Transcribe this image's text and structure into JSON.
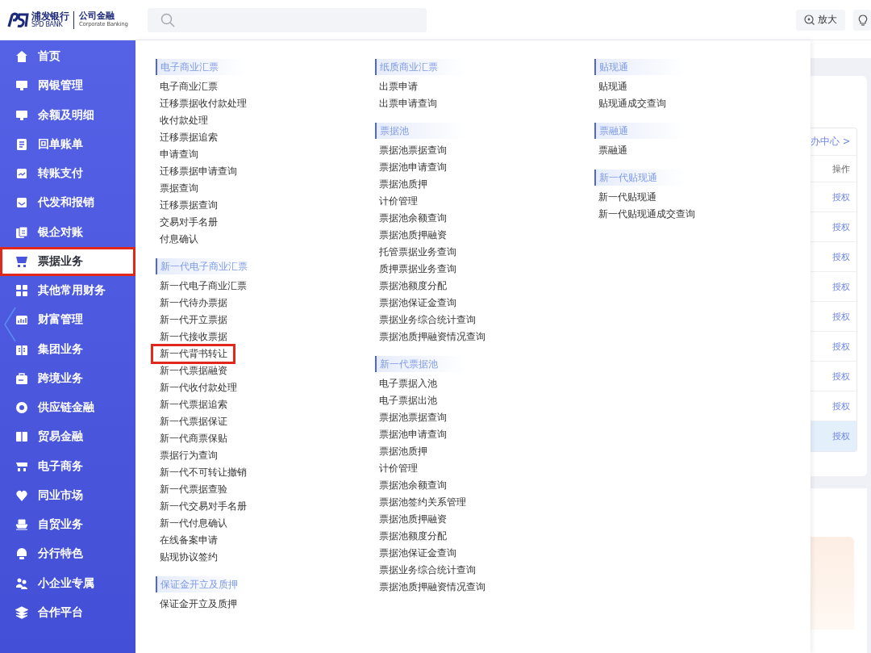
{
  "header": {
    "logo": {
      "bank_name": "浦发银行",
      "bank_name_en": "SPD BANK",
      "division": "公司金融",
      "division_en": "Corporate Banking"
    },
    "buttons": [
      {
        "kind": "zoom",
        "label": "放大"
      },
      {
        "kind": "bulb"
      }
    ]
  },
  "sidebar": {
    "items": [
      {
        "label": "首页",
        "selected": false,
        "highlighted": false
      },
      {
        "label": "网银管理",
        "selected": false,
        "highlighted": false
      },
      {
        "label": "余额及明细",
        "selected": false,
        "highlighted": false
      },
      {
        "label": "回单账单",
        "selected": false,
        "highlighted": false
      },
      {
        "label": "转账支付",
        "selected": false,
        "highlighted": false
      },
      {
        "label": "代发和报销",
        "selected": false,
        "highlighted": false
      },
      {
        "label": "银企对账",
        "selected": false,
        "highlighted": false
      },
      {
        "label": "票据业务",
        "selected": true,
        "highlighted": true
      },
      {
        "label": "其他常用财务",
        "selected": false,
        "highlighted": false
      },
      {
        "label": "财富管理",
        "selected": false,
        "highlighted": false
      },
      {
        "label": "集团业务",
        "selected": false,
        "highlighted": false
      },
      {
        "label": "跨境业务",
        "selected": false,
        "highlighted": false
      },
      {
        "label": "供应链金融",
        "selected": false,
        "highlighted": false
      },
      {
        "label": "贸易金融",
        "selected": false,
        "highlighted": false
      },
      {
        "label": "电子商务",
        "selected": false,
        "highlighted": false
      },
      {
        "label": "同业市场",
        "selected": false,
        "highlighted": false
      },
      {
        "label": "自贸业务",
        "selected": false,
        "highlighted": false
      },
      {
        "label": "分行特色",
        "selected": false,
        "highlighted": false
      },
      {
        "label": "小企业专属",
        "selected": false,
        "highlighted": false
      },
      {
        "label": "合作平台",
        "selected": false,
        "highlighted": false
      }
    ]
  },
  "menu": {
    "columns": [
      {
        "sections": [
          {
            "title": "电子商业汇票",
            "items": [
              {
                "label": "电子商业汇票",
                "highlighted": false
              },
              {
                "label": "迁移票据收付款处理",
                "highlighted": false
              },
              {
                "label": "收付款处理",
                "highlighted": false
              },
              {
                "label": "迁移票据追索",
                "highlighted": false
              },
              {
                "label": "申请查询",
                "highlighted": false
              },
              {
                "label": "迁移票据申请查询",
                "highlighted": false
              },
              {
                "label": "票据查询",
                "highlighted": false
              },
              {
                "label": "迁移票据查询",
                "highlighted": false
              },
              {
                "label": "交易对手名册",
                "highlighted": false
              },
              {
                "label": "付息确认",
                "highlighted": false
              }
            ]
          },
          {
            "title": "新一代电子商业汇票",
            "items": [
              {
                "label": "新一代电子商业汇票",
                "highlighted": false
              },
              {
                "label": "新一代待办票据",
                "highlighted": false
              },
              {
                "label": "新一代开立票据",
                "highlighted": false
              },
              {
                "label": "新一代接收票据",
                "highlighted": false
              },
              {
                "label": "新一代背书转让",
                "highlighted": true
              },
              {
                "label": "新一代票据融资",
                "highlighted": false
              },
              {
                "label": "新一代收付款处理",
                "highlighted": false
              },
              {
                "label": "新一代票据追索",
                "highlighted": false
              },
              {
                "label": "新一代票据保证",
                "highlighted": false
              },
              {
                "label": "新一代商票保贴",
                "highlighted": false
              },
              {
                "label": "票据行为查询",
                "highlighted": false
              },
              {
                "label": "新一代不可转让撤销",
                "highlighted": false
              },
              {
                "label": "新一代票据查验",
                "highlighted": false
              },
              {
                "label": "新一代交易对手名册",
                "highlighted": false
              },
              {
                "label": "新一代付息确认",
                "highlighted": false
              },
              {
                "label": "在线备案申请",
                "highlighted": false
              },
              {
                "label": "贴现协议签约",
                "highlighted": false
              }
            ]
          },
          {
            "title": "保证金开立及质押",
            "items": [
              {
                "label": "保证金开立及质押",
                "highlighted": false
              }
            ]
          }
        ]
      },
      {
        "sections": [
          {
            "title": "纸质商业汇票",
            "items": [
              {
                "label": "出票申请",
                "highlighted": false
              },
              {
                "label": "出票申请查询",
                "highlighted": false
              }
            ]
          },
          {
            "title": "票据池",
            "items": [
              {
                "label": "票据池票据查询",
                "highlighted": false
              },
              {
                "label": "票据池申请查询",
                "highlighted": false
              },
              {
                "label": "票据池质押",
                "highlighted": false
              },
              {
                "label": "计价管理",
                "highlighted": false
              },
              {
                "label": "票据池余额查询",
                "highlighted": false
              },
              {
                "label": "票据池质押融资",
                "highlighted": false
              },
              {
                "label": "托管票据业务查询",
                "highlighted": false
              },
              {
                "label": "质押票据业务查询",
                "highlighted": false
              },
              {
                "label": "票据池额度分配",
                "highlighted": false
              },
              {
                "label": "票据池保证金查询",
                "highlighted": false
              },
              {
                "label": "票据业务综合统计查询",
                "highlighted": false
              },
              {
                "label": "票据池质押融资情况查询",
                "highlighted": false
              }
            ]
          },
          {
            "title": "新一代票据池",
            "items": [
              {
                "label": "电子票据入池",
                "highlighted": false
              },
              {
                "label": "电子票据出池",
                "highlighted": false
              },
              {
                "label": "票据池票据查询",
                "highlighted": false
              },
              {
                "label": "票据池申请查询",
                "highlighted": false
              },
              {
                "label": "票据池质押",
                "highlighted": false
              },
              {
                "label": "计价管理",
                "highlighted": false
              },
              {
                "label": "票据池余额查询",
                "highlighted": false
              },
              {
                "label": "票据池签约关系管理",
                "highlighted": false
              },
              {
                "label": "票据池质押融资",
                "highlighted": false
              },
              {
                "label": "票据池额度分配",
                "highlighted": false
              },
              {
                "label": "票据池保证金查询",
                "highlighted": false
              },
              {
                "label": "票据业务综合统计查询",
                "highlighted": false
              },
              {
                "label": "票据池质押融资情况查询",
                "highlighted": false
              }
            ]
          }
        ]
      },
      {
        "sections": [
          {
            "title": "贴现通",
            "items": [
              {
                "label": "贴现通",
                "highlighted": false
              },
              {
                "label": "贴现通成交查询",
                "highlighted": false
              }
            ]
          },
          {
            "title": "票融通",
            "items": [
              {
                "label": "票融通",
                "highlighted": false
              }
            ]
          },
          {
            "title": "新一代贴现通",
            "items": [
              {
                "label": "新一代贴现通",
                "highlighted": false
              },
              {
                "label": "新一代贴现通成交查询",
                "highlighted": false
              }
            ]
          }
        ]
      }
    ]
  },
  "background_page": {
    "link": "办中心 >",
    "column_header": "操作",
    "actions": [
      "授权",
      "授权",
      "授权",
      "授权",
      "授权",
      "授权",
      "授权",
      "授权",
      "授权"
    ]
  }
}
